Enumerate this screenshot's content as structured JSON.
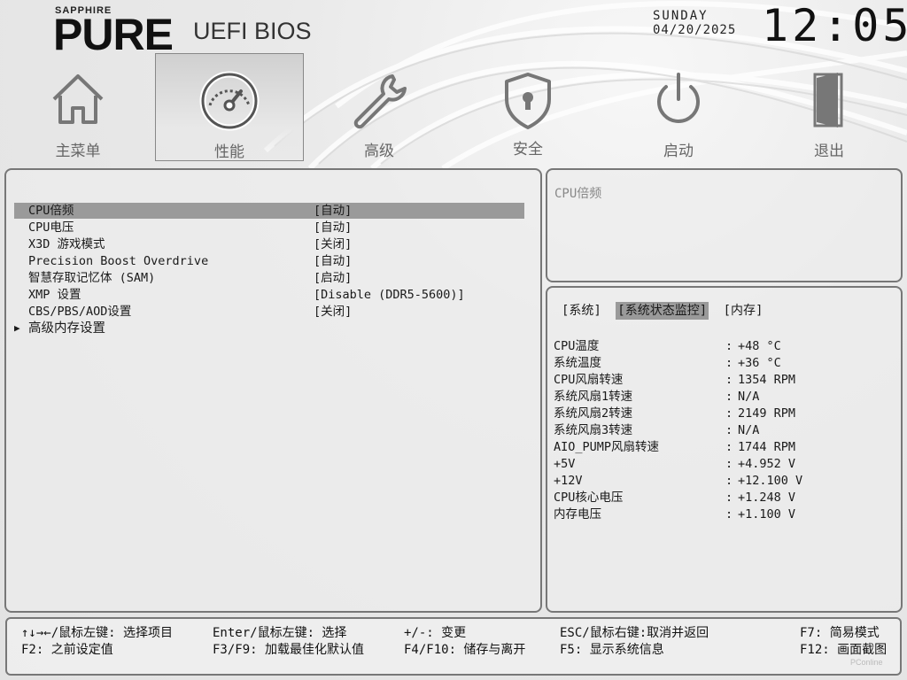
{
  "header": {
    "brand_top": "SAPPHIRE",
    "brand_main": "PURE",
    "brand_sub": "UEFI BIOS",
    "day": "SUNDAY",
    "date": "04/20/2025",
    "time": "12:05"
  },
  "tabs": [
    {
      "label": "主菜单",
      "icon": "home-icon"
    },
    {
      "label": "性能",
      "icon": "speedometer-icon",
      "active": true
    },
    {
      "label": "高级",
      "icon": "wrench-icon"
    },
    {
      "label": "安全",
      "icon": "shield-lock-icon"
    },
    {
      "label": "启动",
      "icon": "power-icon"
    },
    {
      "label": "退出",
      "icon": "exit-door-icon"
    }
  ],
  "menu": [
    {
      "label": "CPU倍频",
      "value": "[自动]",
      "selected": true
    },
    {
      "label": "CPU电压",
      "value": "[自动]"
    },
    {
      "label": "X3D 游戏模式",
      "value": "[关闭]"
    },
    {
      "label": "Precision Boost Overdrive",
      "value": "[自动]"
    },
    {
      "label": "智慧存取记忆体 (SAM)",
      "value": "[启动]"
    },
    {
      "label": "XMP 设置",
      "value": "[Disable (DDR5-5600)]"
    },
    {
      "label": "CBS/PBS/AOD设置",
      "value": "[关闭]"
    },
    {
      "label": "高级内存设置",
      "value": "",
      "submenu": true
    }
  ],
  "help": {
    "text": "CPU倍频"
  },
  "info": {
    "tabs": [
      {
        "label": "[系统]"
      },
      {
        "label": "[系统状态监控]",
        "active": true
      },
      {
        "label": "[内存]"
      }
    ],
    "rows": [
      {
        "label": "CPU温度",
        "value": "+48 °C"
      },
      {
        "label": "系统温度",
        "value": "+36 °C"
      },
      {
        "label": "CPU风扇转速",
        "value": "1354 RPM"
      },
      {
        "label": "系统风扇1转速",
        "value": "N/A"
      },
      {
        "label": "系统风扇2转速",
        "value": "2149 RPM"
      },
      {
        "label": "系统风扇3转速",
        "value": "N/A"
      },
      {
        "label": "AIO_PUMP风扇转速",
        "value": "1744 RPM"
      },
      {
        "label": "+5V",
        "value": "+4.952 V"
      },
      {
        "label": "+12V",
        "value": "+12.100 V"
      },
      {
        "label": "CPU核心电压",
        "value": "+1.248 V"
      },
      {
        "label": "内存电压",
        "value": "+1.100 V"
      }
    ]
  },
  "footer": {
    "k1": "↑↓→←/鼠标左键: 选择项目",
    "k2": "F2: 之前设定值",
    "k3": "Enter/鼠标左键: 选择",
    "k4": "F3/F9: 加载最佳化默认值",
    "k5": "+/-: 变更",
    "k6": "F4/F10: 储存与离开",
    "k7": "ESC/鼠标右键:取消并返回",
    "k8": "F5: 显示系统信息",
    "k9": "F7: 简易模式",
    "k10": "F12: 画面截图"
  },
  "watermark": "PConline"
}
